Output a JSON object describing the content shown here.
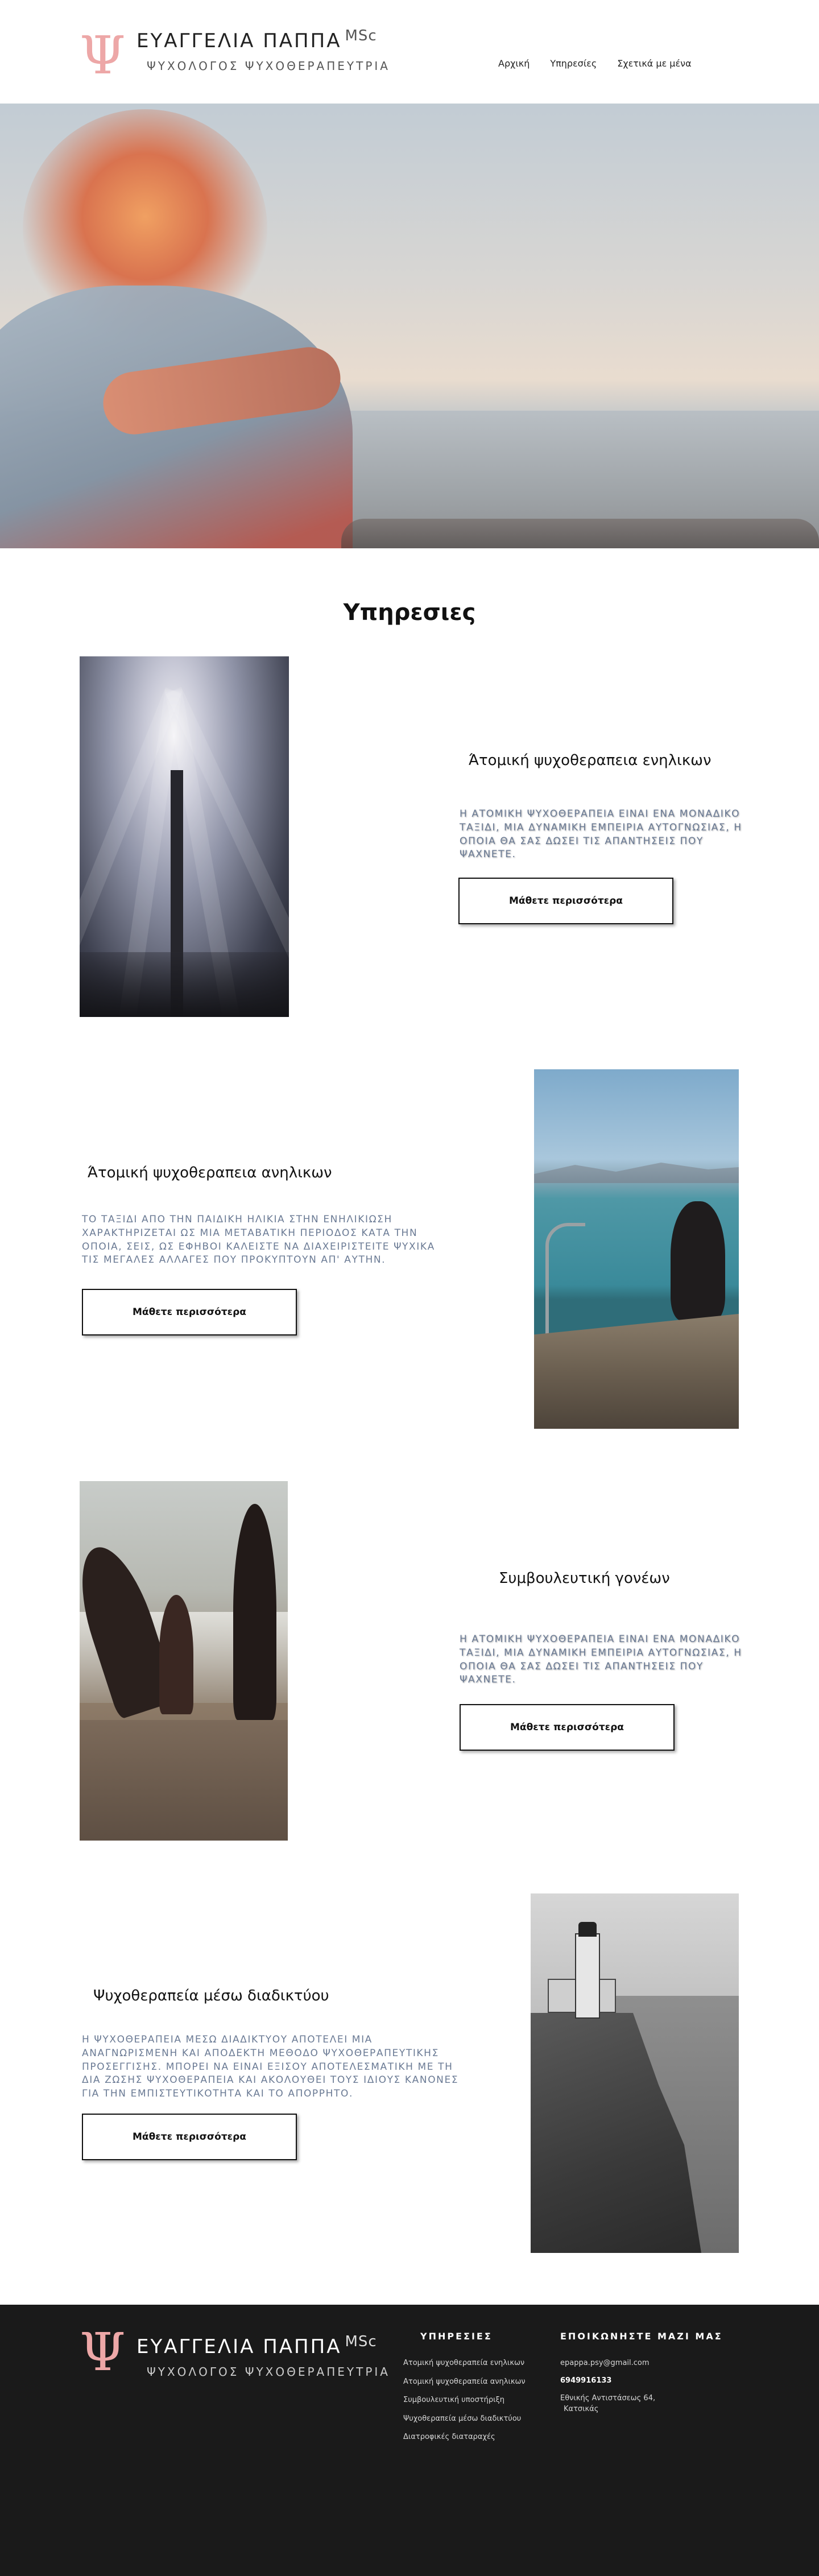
{
  "brand": {
    "symbol": "Ψ",
    "name": "ΕΥΑΓΓΕΛΙΑ ΠΑΠΠΑ",
    "degree": "MSc",
    "subtitle": "ΨΥΧΟΛΟΓΟΣ ΨΥΧΟΘΕΡΑΠΕΥΤΡΙΑ",
    "accent_color": "#eda7a7"
  },
  "nav": {
    "items": [
      {
        "label": "Αρχική"
      },
      {
        "label": "Υπηρεσίες"
      },
      {
        "label": "Σχετικά με μένα"
      }
    ]
  },
  "services": {
    "title": "Υπηρεσιες",
    "items": [
      {
        "title": "Άτομική ψυχοθεραπεια ενηλικων",
        "text": "Η ΑΤΟΜΙΚΗ ΨΥΧΟΘΕΡΑΠΕΙΑ ΕΙΝΑΙ ΕΝΑ ΜΟΝΑΔΙΚΟ ΤΑΞΙΔΙ, ΜΙΑ ΔΥΝΑΜΙΚΗ ΕΜΠΕΙΡΙΑ ΑΥΤΟΓΝΩΣΙΑΣ, Η ΟΠΟΙΑ ΘΑ ΣΑΣ ΔΩΣΕΙ ΤΙΣ ΑΠΑΝΤΗΣΕΙΣ ΠΟΥ ΨΑΧΝΕΤΕ.",
        "button": "Μάθετε περισσότερα"
      },
      {
        "title": "Άτομική ψυχοθεραπεια ανηλικων",
        "text": "ΤΟ ΤΑΞΙΔΙ ΑΠΟ ΤΗΝ ΠΑΙΔΙΚΗ ΗΛΙΚΙΑ ΣΤΗΝ ΕΝΗΛΙΚΙΩΣΗ ΧΑΡΑΚΤΗΡΙΖΕΤΑΙ ΩΣ ΜΙΑ ΜΕΤΑΒΑΤΙΚΗ ΠΕΡΙΟΔΟΣ ΚΑΤΑ ΤΗΝ ΟΠΟΙΑ, ΣΕΙΣ, ΩΣ ΕΦΗΒΟΙ ΚΑΛΕΙΣΤΕ ΝΑ ΔΙΑΧΕΙΡΙΣΤΕΙΤΕ ΨΥΧΙΚΑ ΤΙΣ ΜΕΓΑΛΕΣ ΑΛΛΑΓΕΣ ΠΟΥ ΠΡΟΚΥΠΤΟΥΝ ΑΠ' ΑΥΤΗΝ.",
        "button": "Μάθετε περισσότερα"
      },
      {
        "title": "Συμβουλευτική γονέων",
        "text": "Η ΑΤΟΜΙΚΗ ΨΥΧΟΘΕΡΑΠΕΙΑ ΕΙΝΑΙ ΕΝΑ ΜΟΝΑΔΙΚΟ ΤΑΞΙΔΙ, ΜΙΑ ΔΥΝΑΜΙΚΗ ΕΜΠΕΙΡΙΑ ΑΥΤΟΓΝΩΣΙΑΣ, Η ΟΠΟΙΑ ΘΑ ΣΑΣ ΔΩΣΕΙ ΤΙΣ ΑΠΑΝΤΗΣΕΙΣ ΠΟΥ ΨΑΧΝΕΤΕ.",
        "button": "Μάθετε περισσότερα"
      },
      {
        "title": "Ψυχοθεραπεία μέσω διαδικτύου",
        "text": "Η ΨΥΧΟΘΕΡΑΠΕΙΑ ΜΕΣΩ ΔΙΑΔΙΚΤΥΟΥ ΑΠΟΤΕΛΕΙ ΜΙΑ ΑΝΑΓΝΩΡΙΣΜΕΝΗ ΚΑΙ ΑΠΟΔΕΚΤΗ ΜΕΘΟΔΟ ΨΥΧΟΘΕΡΑΠΕΥΤΙΚΗΣ ΠΡΟΣΕΓΓΙΣΗΣ. ΜΠΟΡΕΙ ΝΑ ΕΙΝΑΙ ΕΞΙΣΟΥ ΑΠΟΤΕΛΕΣΜΑΤΙΚΗ ΜΕ ΤΗ ΔΙΑ ΖΩΣΗΣ ΨΥΧΟΘΕΡΑΠΕΙΑ ΚΑΙ ΑΚΟΛΟΥΘΕΙ ΤΟΥΣ ΙΔΙΟΥΣ ΚΑΝΟΝΕΣ ΓΙΑ ΤΗΝ ΕΜΠΙΣΤΕΥΤΙΚΟΤΗΤΑ ΚΑΙ ΤΟ ΑΠΟΡΡΗΤΟ.",
        "button": "Μάθετε περισσότερα"
      }
    ]
  },
  "footer": {
    "services_title": "ΥΠΗΡΕΣΙΕΣ",
    "links": [
      "Ατομική ψυχοθεραπεία ενηλικων",
      "Ατομική ψυχοθεραπεία ανηλικων",
      "Συμβουλευτική υποστήριξη",
      "Ψυχοθεραπεία μέσω διαδικτύου",
      "Διατροφικές διαταραχές"
    ],
    "contact_title": "ΕΠΟΙΚΩΝΗΣΤΕ ΜΑΖΙ ΜΑΣ",
    "email": "epappa.psy@gmail.com",
    "phone": "6949916133",
    "address_line1": "Εθνικής Αντιστάσεως 64,",
    "address_line2": "Κατσικάς"
  }
}
